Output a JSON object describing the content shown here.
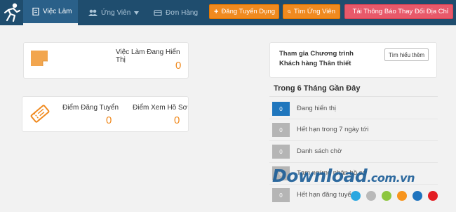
{
  "nav": {
    "jobs": "Việc Làm",
    "candidates": "Ứng Viên",
    "orders": "Đơn Hàng"
  },
  "buttons": {
    "post_job": "Đăng Tuyển Dụng",
    "find_candidate": "Tìm Ứng Viên",
    "download_notice": "Tải Thông Báo Thay Đổi Địa Chỉ"
  },
  "card_active_jobs": {
    "label": "Việc Làm Đang Hiển Thị",
    "value": "0"
  },
  "card_points": {
    "post_label": "Điểm Đăng Tuyển",
    "post_value": "0",
    "view_label": "Điểm Xem Hồ Sơ",
    "view_value": "0"
  },
  "loyalty": {
    "text": "Tham gia Chương trình Khách hàng Thân thiết",
    "button": "Tìm hiểu thêm"
  },
  "recent": {
    "title": "Trong 6 Tháng Gần Đây",
    "rows": [
      {
        "count": "0",
        "label": "Đang hiển thị"
      },
      {
        "count": "0",
        "label": "Hết hạn trong 7 ngày tới"
      },
      {
        "count": "0",
        "label": "Danh sách chờ"
      },
      {
        "count": "0",
        "label": "Tạm ngừng nhận hồ sơ"
      },
      {
        "count": "0",
        "label": "Hết hạn đăng tuyển"
      }
    ]
  },
  "watermark": {
    "text": "Download",
    "suffix": ".com.vn",
    "dot_colors": [
      "#2aa7e0",
      "#b9b9b9",
      "#8dc63f",
      "#f7941d",
      "#1e73be",
      "#e31e24"
    ]
  },
  "colors": {
    "topbar": "#1f4d6e",
    "accent_orange": "#f08a1f",
    "accent_red": "#e8596a",
    "badge_blue": "#1f76bd"
  }
}
